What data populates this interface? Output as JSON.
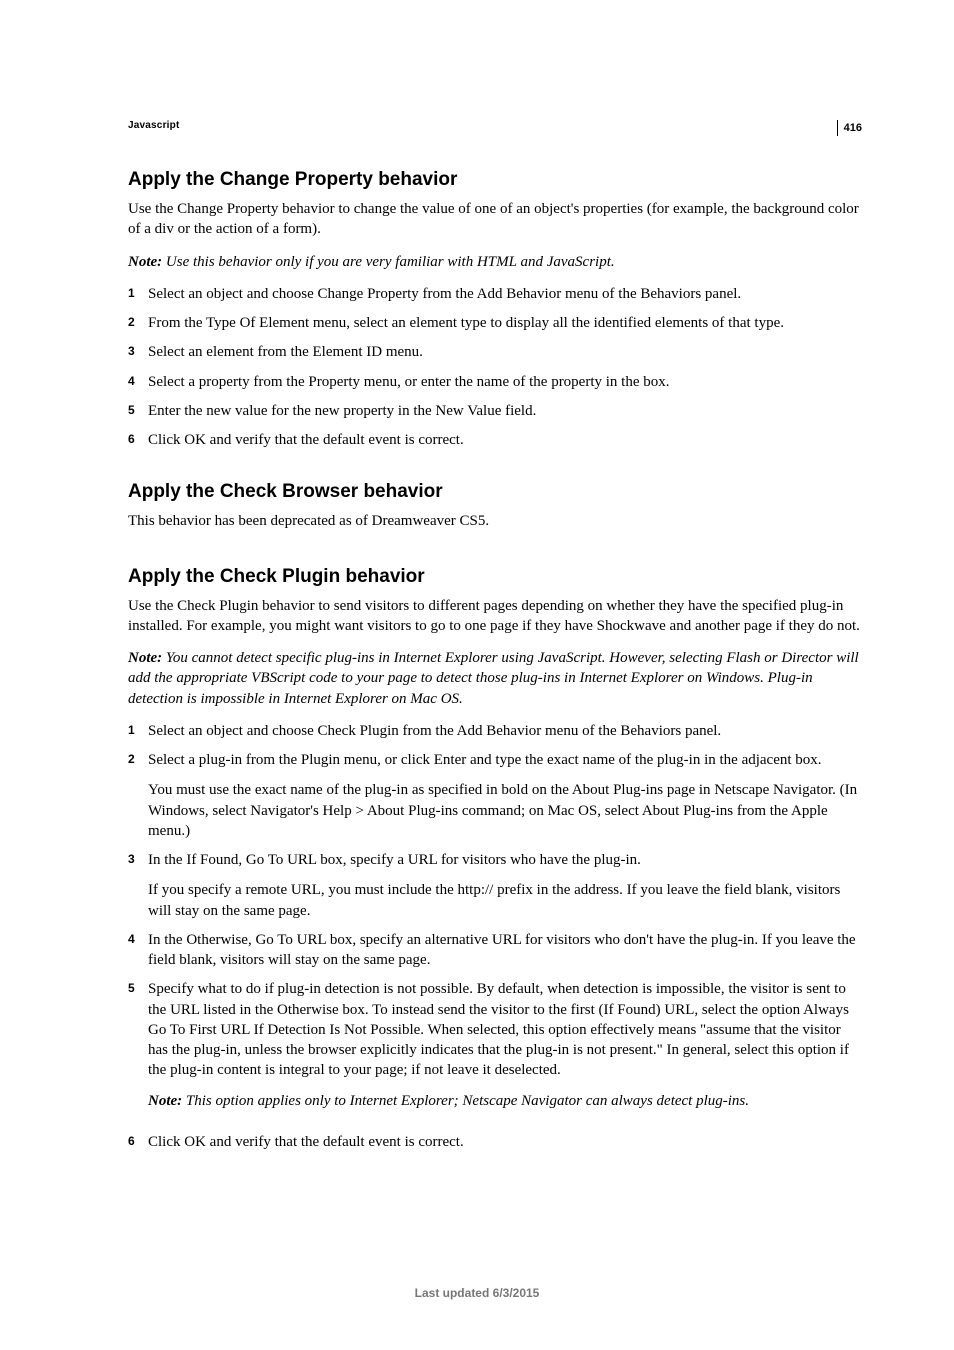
{
  "page_number": "416",
  "chapter": "Javascript",
  "footer": "Last updated 6/3/2015",
  "sections": [
    {
      "heading": "Apply the Change Property behavior",
      "intro": "Use the Change Property behavior to change the value of one of an object's properties (for example, the background color of a div or the action of a form).",
      "note": {
        "label": "Note:",
        "text": " Use this behavior only if you are very familiar with HTML and JavaScript."
      },
      "steps": [
        {
          "n": "1",
          "body": [
            {
              "text": "Select an object and choose Change Property from the Add Behavior menu of the Behaviors panel."
            }
          ]
        },
        {
          "n": "2",
          "body": [
            {
              "text": "From the Type Of Element menu, select an element type to display all the identified elements of that type."
            }
          ]
        },
        {
          "n": "3",
          "body": [
            {
              "text": "Select an element from the Element ID menu."
            }
          ]
        },
        {
          "n": "4",
          "body": [
            {
              "text": "Select a property from the Property menu, or enter the name of the property in the box."
            }
          ]
        },
        {
          "n": "5",
          "body": [
            {
              "text": "Enter the new value for the new property in the New Value field."
            }
          ]
        },
        {
          "n": "6",
          "body": [
            {
              "text": "Click OK and verify that the default event is correct."
            }
          ]
        }
      ]
    },
    {
      "heading": "Apply the Check Browser behavior",
      "intro": "This behavior has been deprecated as of Dreamweaver CS5."
    },
    {
      "heading": "Apply the Check Plugin behavior",
      "intro": "Use the Check Plugin behavior to send visitors to different pages depending on whether they have the specified plug-in installed. For example, you might want visitors to go to one page if they have Shockwave and another page if they do not.",
      "note": {
        "label": "Note:",
        "text": " You cannot detect specific plug-ins in Internet Explorer using JavaScript. However, selecting Flash or Director will add the appropriate VBScript code to your page to detect those plug-ins in Internet Explorer on Windows. Plug-in detection is impossible in Internet Explorer on Mac OS."
      },
      "steps": [
        {
          "n": "1",
          "body": [
            {
              "text": "Select an object and choose Check Plugin from the Add Behavior menu of the Behaviors panel."
            }
          ]
        },
        {
          "n": "2",
          "body": [
            {
              "text": "Select a plug-in from the Plugin menu, or click Enter and type the exact name of the plug-in in the adjacent box."
            },
            {
              "text": "You must use the exact name of the plug-in as specified in bold on the About Plug-ins page in Netscape Navigator. (In Windows, select Navigator's Help > About Plug-ins command; on Mac OS, select About Plug-ins from the Apple menu.)"
            }
          ]
        },
        {
          "n": "3",
          "body": [
            {
              "text": "In the If Found, Go To URL box, specify a URL for visitors who have the plug-in."
            },
            {
              "text": "If you specify a remote URL, you must include the http:// prefix in the address. If you leave the field blank, visitors will stay on the same page."
            }
          ]
        },
        {
          "n": "4",
          "body": [
            {
              "text": "In the Otherwise, Go To URL box, specify an alternative URL for visitors who don't have the plug-in. If you leave the field blank, visitors will stay on the same page."
            }
          ]
        },
        {
          "n": "5",
          "body": [
            {
              "text": "Specify what to do if plug-in detection is not possible. By default, when detection is impossible, the visitor is sent to the URL listed in the Otherwise box. To instead send the visitor to the first (If Found) URL, select the option Always Go To First URL If Detection Is Not Possible. When selected, this option effectively means \"assume that the visitor has the plug-in, unless the browser explicitly indicates that the plug-in is not present.\" In general, select this option if the plug-in content is integral to your page; if not leave it deselected."
            },
            {
              "note": {
                "label": "Note:",
                "text": " This option applies only to Internet Explorer; Netscape Navigator can always detect plug-ins."
              }
            }
          ]
        },
        {
          "n": "6",
          "body": [
            {
              "text": "Click OK and verify that the default event is correct."
            }
          ]
        }
      ]
    }
  ]
}
